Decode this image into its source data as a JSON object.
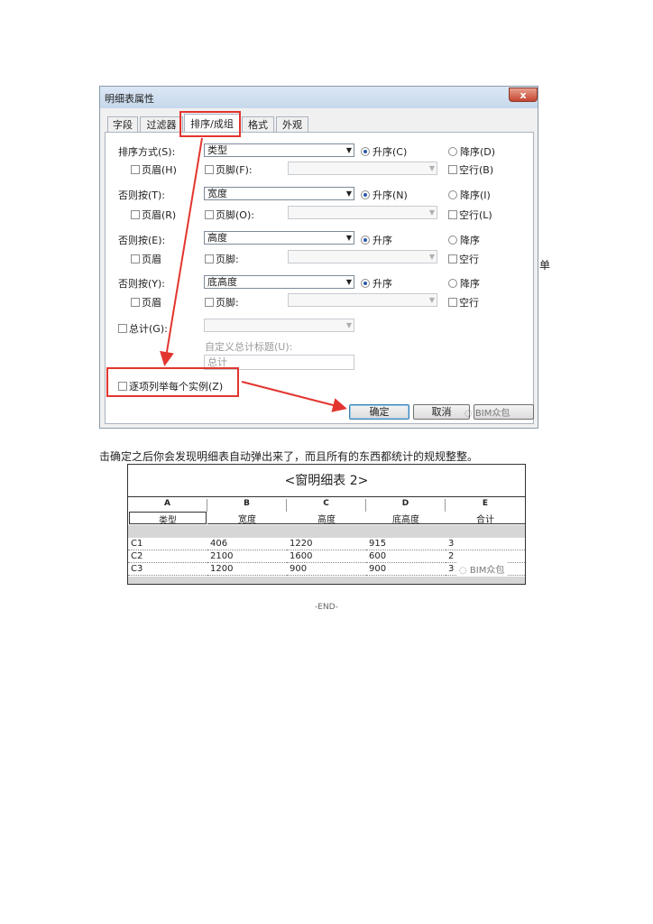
{
  "dialog": {
    "title": "明细表属性",
    "close_label": "x",
    "tabs": [
      "字段",
      "过滤器",
      "排序/成组",
      "格式",
      "外观"
    ],
    "rows": [
      {
        "label": "排序方式(S):",
        "value": "类型",
        "asc": "升序(C)",
        "desc": "降序(D)",
        "header": "页眉(H)",
        "footer": "页脚(F):",
        "blank": "空行(B)"
      },
      {
        "label": "否则按(T):",
        "value": "宽度",
        "asc": "升序(N)",
        "desc": "降序(I)",
        "header": "页眉(R)",
        "footer": "页脚(O):",
        "blank": "空行(L)"
      },
      {
        "label": "否则按(E):",
        "value": "高度",
        "asc": "升序",
        "desc": "降序",
        "header": "页眉",
        "footer": "页脚:",
        "blank": "空行"
      },
      {
        "label": "否则按(Y):",
        "value": "底高度",
        "asc": "升序",
        "desc": "降序",
        "header": "页眉",
        "footer": "页脚:",
        "blank": "空行"
      }
    ],
    "total_label": "总计(G):",
    "custom_total_label": "自定义总计标题(U):",
    "custom_total_value": "总计",
    "itemize_label": "逐项列举每个实例(Z)",
    "ok_label": "确定",
    "cancel_label": "取消",
    "watermark": "BIM众包"
  },
  "stray_char": "单",
  "paragraph": "击确定之后你会发现明细表自动弹出来了，而且所有的东西都统计的规规整整。",
  "schedule": {
    "title": "<窗明细表 2>",
    "col_letters": [
      "A",
      "B",
      "C",
      "D",
      "E"
    ],
    "col_names": [
      "类型",
      "宽度",
      "高度",
      "底高度",
      "合计"
    ],
    "rows": [
      [
        "C1",
        "406",
        "1220",
        "915",
        "3"
      ],
      [
        "C2",
        "2100",
        "1600",
        "600",
        "2"
      ],
      [
        "C3",
        "1200",
        "900",
        "900",
        "3"
      ]
    ],
    "watermark": "BIM众包"
  },
  "end_marker": "-END-",
  "colors": {
    "annotation_red": "#e3352f",
    "dialog_bg": "#f0f0f0",
    "radio_dot": "#2a58a8"
  },
  "icons": [
    "wechat-icon",
    "dropdown-arrow-icon",
    "close-icon"
  ]
}
